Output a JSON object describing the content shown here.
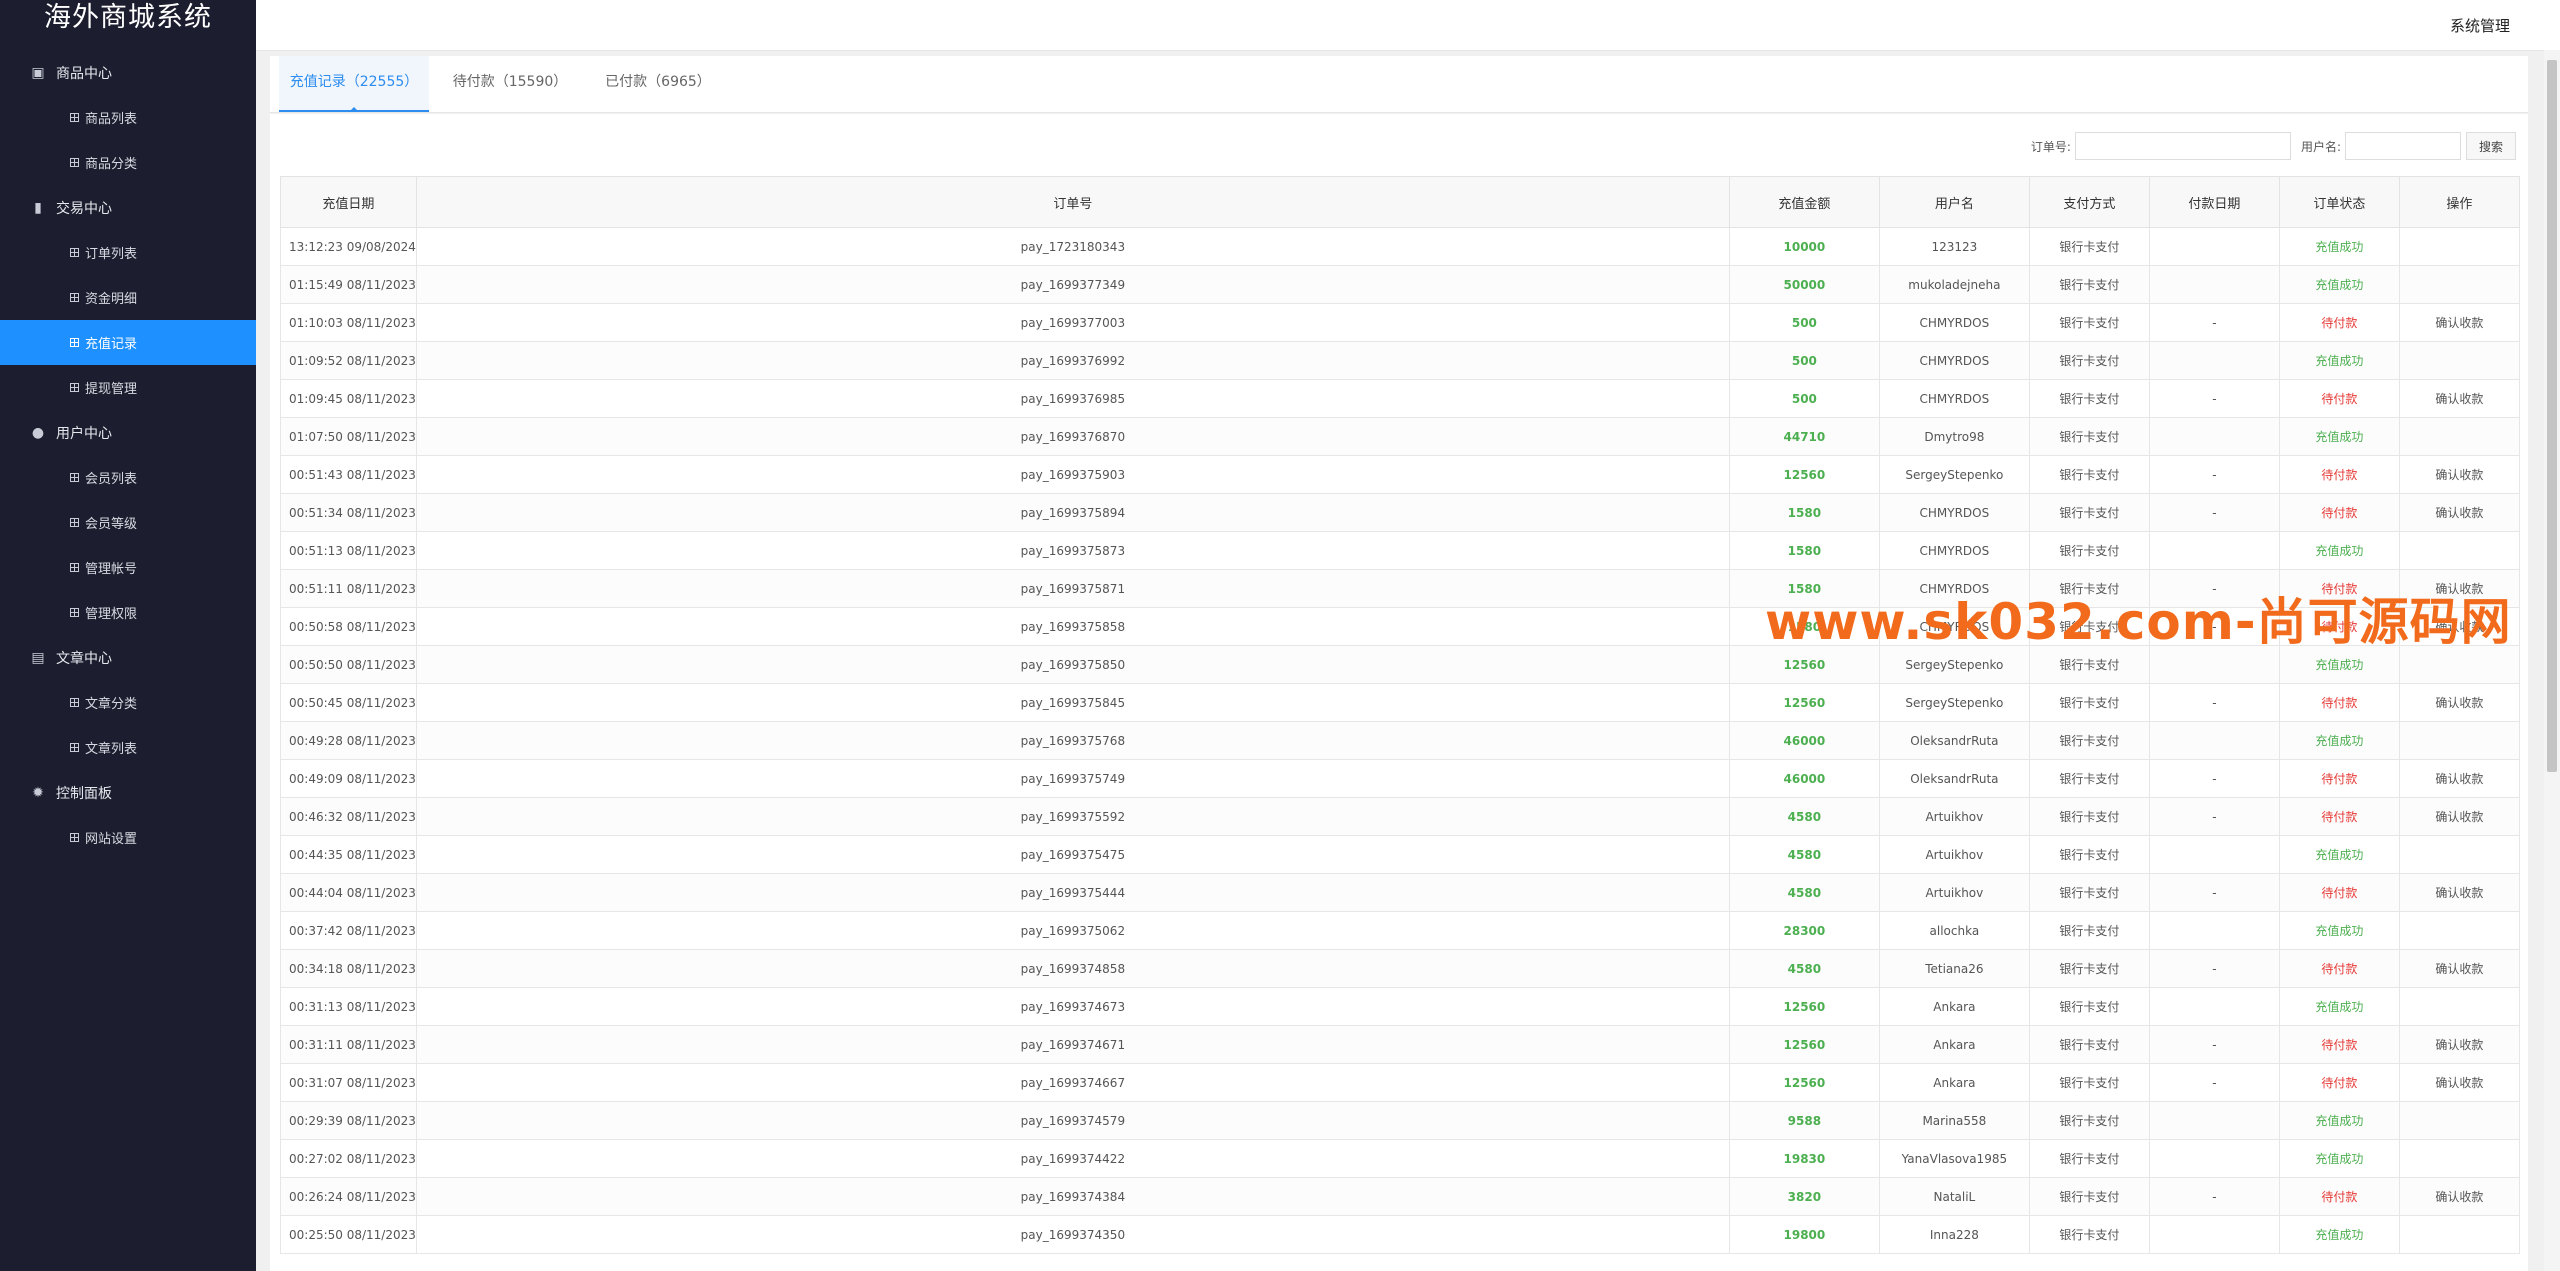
{
  "app": {
    "brand": "海外商城系统",
    "system_menu": "系统管理"
  },
  "sidebar": {
    "groups": [
      {
        "label": "商品中心",
        "icon": "grid-icon",
        "items": [
          "商品列表",
          "商品分类"
        ]
      },
      {
        "label": "交易中心",
        "icon": "bar-chart-icon",
        "items": [
          "订单列表",
          "资金明细",
          "充值记录",
          "提现管理"
        ]
      },
      {
        "label": "用户中心",
        "icon": "user-icon",
        "items": [
          "会员列表",
          "会员等级",
          "管理帐号",
          "管理权限"
        ]
      },
      {
        "label": "文章中心",
        "icon": "document-icon",
        "items": [
          "文章分类",
          "文章列表"
        ]
      },
      {
        "label": "控制面板",
        "icon": "gear-icon",
        "items": [
          "网站设置"
        ]
      }
    ],
    "active_item": "充值记录"
  },
  "tabs": [
    {
      "label": "充值记录（22555）",
      "active": true
    },
    {
      "label": "待付款（15590）",
      "active": false
    },
    {
      "label": "已付款（6965）",
      "active": false
    }
  ],
  "search": {
    "order_label": "订单号:",
    "user_label": "用户名:",
    "button": "搜索",
    "order_value": "",
    "user_value": ""
  },
  "colors": {
    "active_menu": "#1e90ff",
    "success": "#4caf50",
    "pending": "#e53935",
    "watermark": "#f26a1b"
  },
  "table": {
    "headers": [
      "充值日期",
      "订单号",
      "充值金额",
      "用户名",
      "支付方式",
      "付款日期",
      "订单状态",
      "操作"
    ],
    "rows": [
      [
        "13:12:23 09/08/2024",
        "pay_1723180343",
        "10000",
        "123123",
        "银行卡支付",
        "",
        "充值成功",
        ""
      ],
      [
        "01:15:49 08/11/2023",
        "pay_1699377349",
        "50000",
        "mukoladejneha",
        "银行卡支付",
        "",
        "充值成功",
        ""
      ],
      [
        "01:10:03 08/11/2023",
        "pay_1699377003",
        "500",
        "CHMYRDOS",
        "银行卡支付",
        "-",
        "待付款",
        "确认收款"
      ],
      [
        "01:09:52 08/11/2023",
        "pay_1699376992",
        "500",
        "CHMYRDOS",
        "银行卡支付",
        "",
        "充值成功",
        ""
      ],
      [
        "01:09:45 08/11/2023",
        "pay_1699376985",
        "500",
        "CHMYRDOS",
        "银行卡支付",
        "-",
        "待付款",
        "确认收款"
      ],
      [
        "01:07:50 08/11/2023",
        "pay_1699376870",
        "44710",
        "Dmytro98",
        "银行卡支付",
        "",
        "充值成功",
        ""
      ],
      [
        "00:51:43 08/11/2023",
        "pay_1699375903",
        "12560",
        "SergeyStepenko",
        "银行卡支付",
        "-",
        "待付款",
        "确认收款"
      ],
      [
        "00:51:34 08/11/2023",
        "pay_1699375894",
        "1580",
        "CHMYRDOS",
        "银行卡支付",
        "-",
        "待付款",
        "确认收款"
      ],
      [
        "00:51:13 08/11/2023",
        "pay_1699375873",
        "1580",
        "CHMYRDOS",
        "银行卡支付",
        "",
        "充值成功",
        ""
      ],
      [
        "00:51:11 08/11/2023",
        "pay_1699375871",
        "1580",
        "CHMYRDOS",
        "银行卡支付",
        "-",
        "待付款",
        "确认收款"
      ],
      [
        "00:50:58 08/11/2023",
        "pay_1699375858",
        "1580",
        "CHMYRDOS",
        "银行卡支付",
        "-",
        "待付款",
        "确认收款"
      ],
      [
        "00:50:50 08/11/2023",
        "pay_1699375850",
        "12560",
        "SergeyStepenko",
        "银行卡支付",
        "",
        "充值成功",
        ""
      ],
      [
        "00:50:45 08/11/2023",
        "pay_1699375845",
        "12560",
        "SergeyStepenko",
        "银行卡支付",
        "-",
        "待付款",
        "确认收款"
      ],
      [
        "00:49:28 08/11/2023",
        "pay_1699375768",
        "46000",
        "OleksandrRuta",
        "银行卡支付",
        "",
        "充值成功",
        ""
      ],
      [
        "00:49:09 08/11/2023",
        "pay_1699375749",
        "46000",
        "OleksandrRuta",
        "银行卡支付",
        "-",
        "待付款",
        "确认收款"
      ],
      [
        "00:46:32 08/11/2023",
        "pay_1699375592",
        "4580",
        "Artuikhov",
        "银行卡支付",
        "-",
        "待付款",
        "确认收款"
      ],
      [
        "00:44:35 08/11/2023",
        "pay_1699375475",
        "4580",
        "Artuikhov",
        "银行卡支付",
        "",
        "充值成功",
        ""
      ],
      [
        "00:44:04 08/11/2023",
        "pay_1699375444",
        "4580",
        "Artuikhov",
        "银行卡支付",
        "-",
        "待付款",
        "确认收款"
      ],
      [
        "00:37:42 08/11/2023",
        "pay_1699375062",
        "28300",
        "allochka",
        "银行卡支付",
        "",
        "充值成功",
        ""
      ],
      [
        "00:34:18 08/11/2023",
        "pay_1699374858",
        "4580",
        "Tetiana26",
        "银行卡支付",
        "-",
        "待付款",
        "确认收款"
      ],
      [
        "00:31:13 08/11/2023",
        "pay_1699374673",
        "12560",
        "Ankara",
        "银行卡支付",
        "",
        "充值成功",
        ""
      ],
      [
        "00:31:11 08/11/2023",
        "pay_1699374671",
        "12560",
        "Ankara",
        "银行卡支付",
        "-",
        "待付款",
        "确认收款"
      ],
      [
        "00:31:07 08/11/2023",
        "pay_1699374667",
        "12560",
        "Ankara",
        "银行卡支付",
        "-",
        "待付款",
        "确认收款"
      ],
      [
        "00:29:39 08/11/2023",
        "pay_1699374579",
        "9588",
        "Marina558",
        "银行卡支付",
        "",
        "充值成功",
        ""
      ],
      [
        "00:27:02 08/11/2023",
        "pay_1699374422",
        "19830",
        "YanaVlasova1985",
        "银行卡支付",
        "",
        "充值成功",
        ""
      ],
      [
        "00:26:24 08/11/2023",
        "pay_1699374384",
        "3820",
        "NataliL",
        "银行卡支付",
        "-",
        "待付款",
        "确认收款"
      ],
      [
        "00:25:50 08/11/2023",
        "pay_1699374350",
        "19800",
        "Inna228",
        "银行卡支付",
        "",
        "充值成功",
        ""
      ]
    ]
  },
  "watermark": "www.sk032.com-尚可源码网"
}
